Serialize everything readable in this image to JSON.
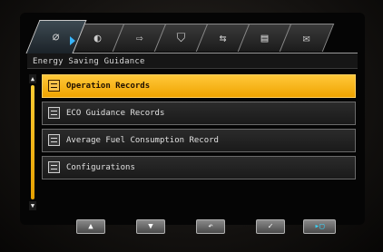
{
  "tabs": [
    {
      "icon": "leaf-icon",
      "glyph": "∅",
      "active": true
    },
    {
      "icon": "car-icon",
      "glyph": "◐",
      "active": false
    },
    {
      "icon": "arrow-icon",
      "glyph": "⇨",
      "active": false
    },
    {
      "icon": "road-icon",
      "glyph": "⛉",
      "active": false
    },
    {
      "icon": "route-icon",
      "glyph": "⇆",
      "active": false
    },
    {
      "icon": "document-icon",
      "glyph": "▤",
      "active": false
    },
    {
      "icon": "mail-icon",
      "glyph": "✉",
      "active": false
    }
  ],
  "title": "Energy Saving Guidance",
  "menu": [
    {
      "label": "Operation Records",
      "selected": true
    },
    {
      "label": "ECO Guidance Records",
      "selected": false
    },
    {
      "label": "Average Fuel Consumption Record",
      "selected": false
    },
    {
      "label": "Configurations",
      "selected": false
    }
  ],
  "scroll": {
    "up": "▲",
    "down": "▼",
    "position": 0
  },
  "softkeys": [
    {
      "name": "up",
      "glyph": "▲"
    },
    {
      "name": "down",
      "glyph": "▼"
    },
    {
      "name": "back",
      "glyph": "↶"
    },
    {
      "name": "confirm",
      "glyph": "✓"
    },
    {
      "name": "switch",
      "glyph": "▸▢"
    }
  ],
  "colors": {
    "accent": "#f0a400",
    "highlight": "#38b6ff"
  }
}
